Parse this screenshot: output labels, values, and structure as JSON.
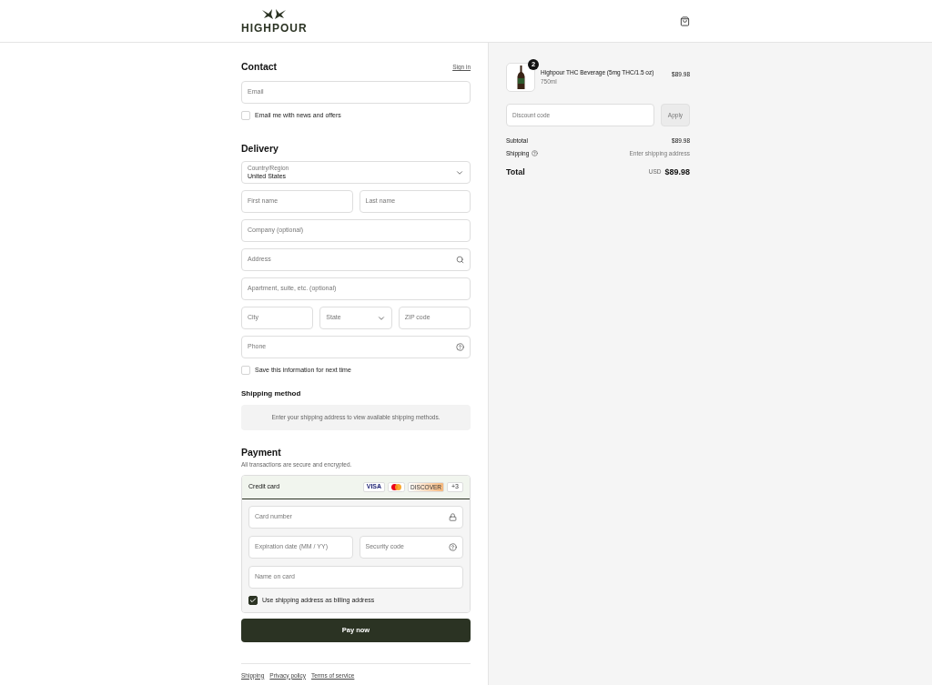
{
  "header": {
    "brand": "HIGHPOUR"
  },
  "contact": {
    "title": "Contact",
    "sign_in": "Sign in",
    "email": {
      "placeholder": "Email"
    },
    "news": {
      "label": "Email me with news and offers",
      "checked": false
    }
  },
  "delivery": {
    "title": "Delivery",
    "rows": [
      [
        {
          "kind": "select",
          "label": "Country/Region",
          "value": "United States"
        }
      ],
      [
        {
          "kind": "text",
          "placeholder": "First name"
        },
        {
          "kind": "text",
          "placeholder": "Last name"
        }
      ],
      [
        {
          "kind": "text",
          "placeholder": "Company (optional)"
        }
      ],
      [
        {
          "kind": "search",
          "placeholder": "Address"
        }
      ],
      [
        {
          "kind": "text",
          "placeholder": "Apartment, suite, etc. (optional)"
        }
      ],
      [
        {
          "kind": "text",
          "placeholder": "City"
        },
        {
          "kind": "select",
          "placeholder": "State"
        },
        {
          "kind": "text",
          "placeholder": "ZIP code"
        }
      ],
      [
        {
          "kind": "help",
          "placeholder": "Phone"
        }
      ]
    ],
    "save": {
      "label": "Save this information for next time",
      "checked": false
    }
  },
  "shipping_method": {
    "title": "Shipping method",
    "notice": "Enter your shipping address to view available shipping methods."
  },
  "payment": {
    "title": "Payment",
    "subtitle": "All transactions are secure and encrypted.",
    "method": {
      "label": "Credit card",
      "selected": true,
      "cards": [
        "VISA",
        "DISCOVER"
      ],
      "more": "+3"
    },
    "rows": [
      [
        {
          "kind": "lock",
          "placeholder": "Card number"
        }
      ],
      [
        {
          "kind": "text",
          "placeholder": "Expiration date (MM / YY)"
        },
        {
          "kind": "help",
          "placeholder": "Security code"
        }
      ],
      [
        {
          "kind": "text",
          "placeholder": "Name on card"
        }
      ]
    ],
    "billing": {
      "label": "Use shipping address as billing address",
      "checked": true
    },
    "pay": "Pay now"
  },
  "footer_links": [
    "Shipping",
    "Privacy policy",
    "Terms of service"
  ],
  "summary": {
    "item": {
      "name": "Highpour THC Beverage (5mg THC/1.5 oz)",
      "variant": "750ml",
      "quantity": "2",
      "price": "$89.98"
    },
    "discount": {
      "placeholder": "Discount code",
      "button": "Apply"
    },
    "subtotal": {
      "label": "Subtotal",
      "value": "$89.98"
    },
    "shipping": {
      "label": "Shipping",
      "value": "Enter shipping address"
    },
    "total": {
      "label": "Total",
      "currency": "USD",
      "value": "$89.98"
    }
  }
}
